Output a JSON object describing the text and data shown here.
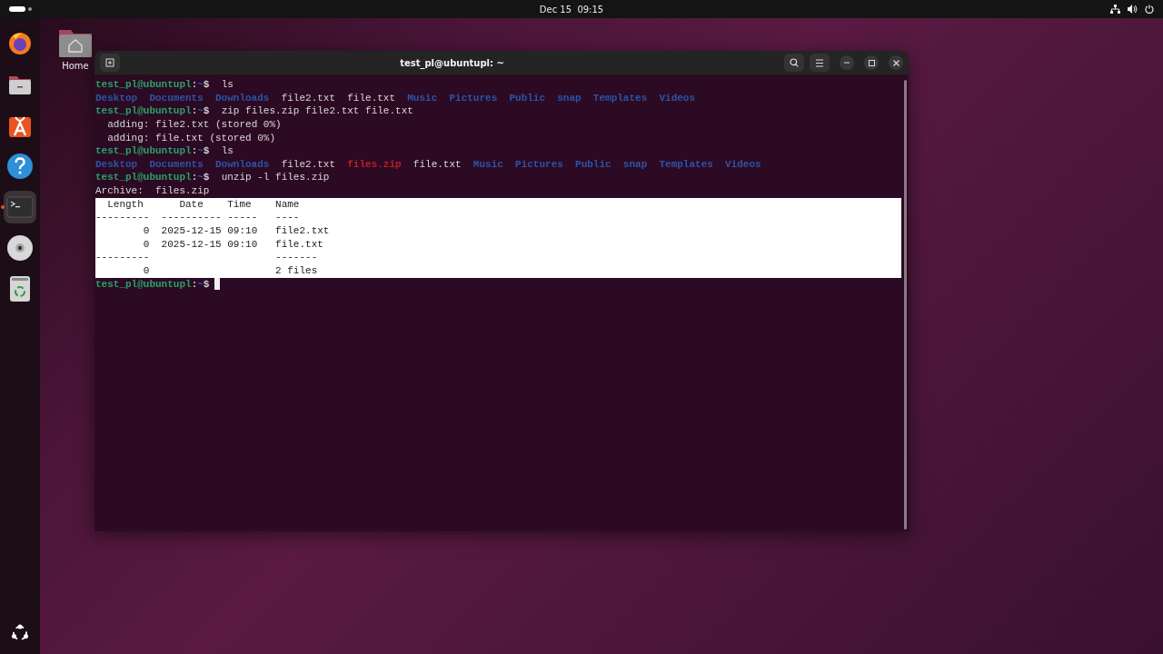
{
  "top_bar": {
    "clock": "Dec 15  09:15"
  },
  "dock": [
    {
      "kind": "browser",
      "active": false
    },
    {
      "kind": "files",
      "active": false
    },
    {
      "kind": "store",
      "active": false
    },
    {
      "kind": "help",
      "active": false
    },
    {
      "kind": "terminal",
      "active": true
    },
    {
      "kind": "disc",
      "active": false
    },
    {
      "kind": "trash",
      "active": false
    }
  ],
  "desktop_icons": [
    {
      "label": "Home"
    }
  ],
  "window": {
    "title": "test_pl@ubuntupl: ~",
    "lines": [
      {
        "kind": "prompt",
        "user": "test_pl@ubuntupl",
        "separator": ":",
        "path": "~",
        "sign": "$",
        "command": "ls",
        "cursor": false
      },
      {
        "kind": "listing",
        "items": [
          {
            "text": "Desktop",
            "kind": "dir"
          },
          {
            "text": "Documents",
            "kind": "dir"
          },
          {
            "text": "Downloads",
            "kind": "dir"
          },
          {
            "text": "file2.txt",
            "kind": "file"
          },
          {
            "text": "file.txt",
            "kind": "file"
          },
          {
            "text": "Music",
            "kind": "dir"
          },
          {
            "text": "Pictures",
            "kind": "dir"
          },
          {
            "text": "Public",
            "kind": "dir"
          },
          {
            "text": "snap",
            "kind": "dir"
          },
          {
            "text": "Templates",
            "kind": "dir"
          },
          {
            "text": "Videos",
            "kind": "dir"
          }
        ]
      },
      {
        "kind": "prompt",
        "user": "test_pl@ubuntupl",
        "separator": ":",
        "path": "~",
        "sign": "$",
        "command": "zip files.zip file2.txt file.txt",
        "cursor": false
      },
      {
        "kind": "output",
        "text": "  adding: file2.txt (stored 0%)",
        "selected": false
      },
      {
        "kind": "output",
        "text": "  adding: file.txt (stored 0%)",
        "selected": false
      },
      {
        "kind": "prompt",
        "user": "test_pl@ubuntupl",
        "separator": ":",
        "path": "~",
        "sign": "$",
        "command": "ls",
        "cursor": false
      },
      {
        "kind": "listing",
        "items": [
          {
            "text": "Desktop",
            "kind": "dir"
          },
          {
            "text": "Documents",
            "kind": "dir"
          },
          {
            "text": "Downloads",
            "kind": "dir"
          },
          {
            "text": "file2.txt",
            "kind": "file"
          },
          {
            "text": "files.zip",
            "kind": "archive"
          },
          {
            "text": "file.txt",
            "kind": "file"
          },
          {
            "text": "Music",
            "kind": "dir"
          },
          {
            "text": "Pictures",
            "kind": "dir"
          },
          {
            "text": "Public",
            "kind": "dir"
          },
          {
            "text": "snap",
            "kind": "dir"
          },
          {
            "text": "Templates",
            "kind": "dir"
          },
          {
            "text": "Videos",
            "kind": "dir"
          }
        ]
      },
      {
        "kind": "prompt",
        "user": "test_pl@ubuntupl",
        "separator": ":",
        "path": "~",
        "sign": "$",
        "command": "unzip -l files.zip",
        "cursor": false
      },
      {
        "kind": "output",
        "text": "Archive:  files.zip",
        "selected": false
      },
      {
        "kind": "output",
        "text": "  Length      Date    Time    Name",
        "selected": true
      },
      {
        "kind": "output",
        "text": "---------  ---------- -----   ----",
        "selected": true
      },
      {
        "kind": "output",
        "text": "        0  2025-12-15 09:10   file2.txt",
        "selected": true
      },
      {
        "kind": "output",
        "text": "        0  2025-12-15 09:10   file.txt",
        "selected": true
      },
      {
        "kind": "output",
        "text": "---------                     -------",
        "selected": true
      },
      {
        "kind": "output",
        "text": "        0                     2 files",
        "selected": true
      },
      {
        "kind": "prompt",
        "user": "test_pl@ubuntupl",
        "separator": ":",
        "path": "~",
        "sign": "$",
        "cursor": true
      }
    ]
  }
}
